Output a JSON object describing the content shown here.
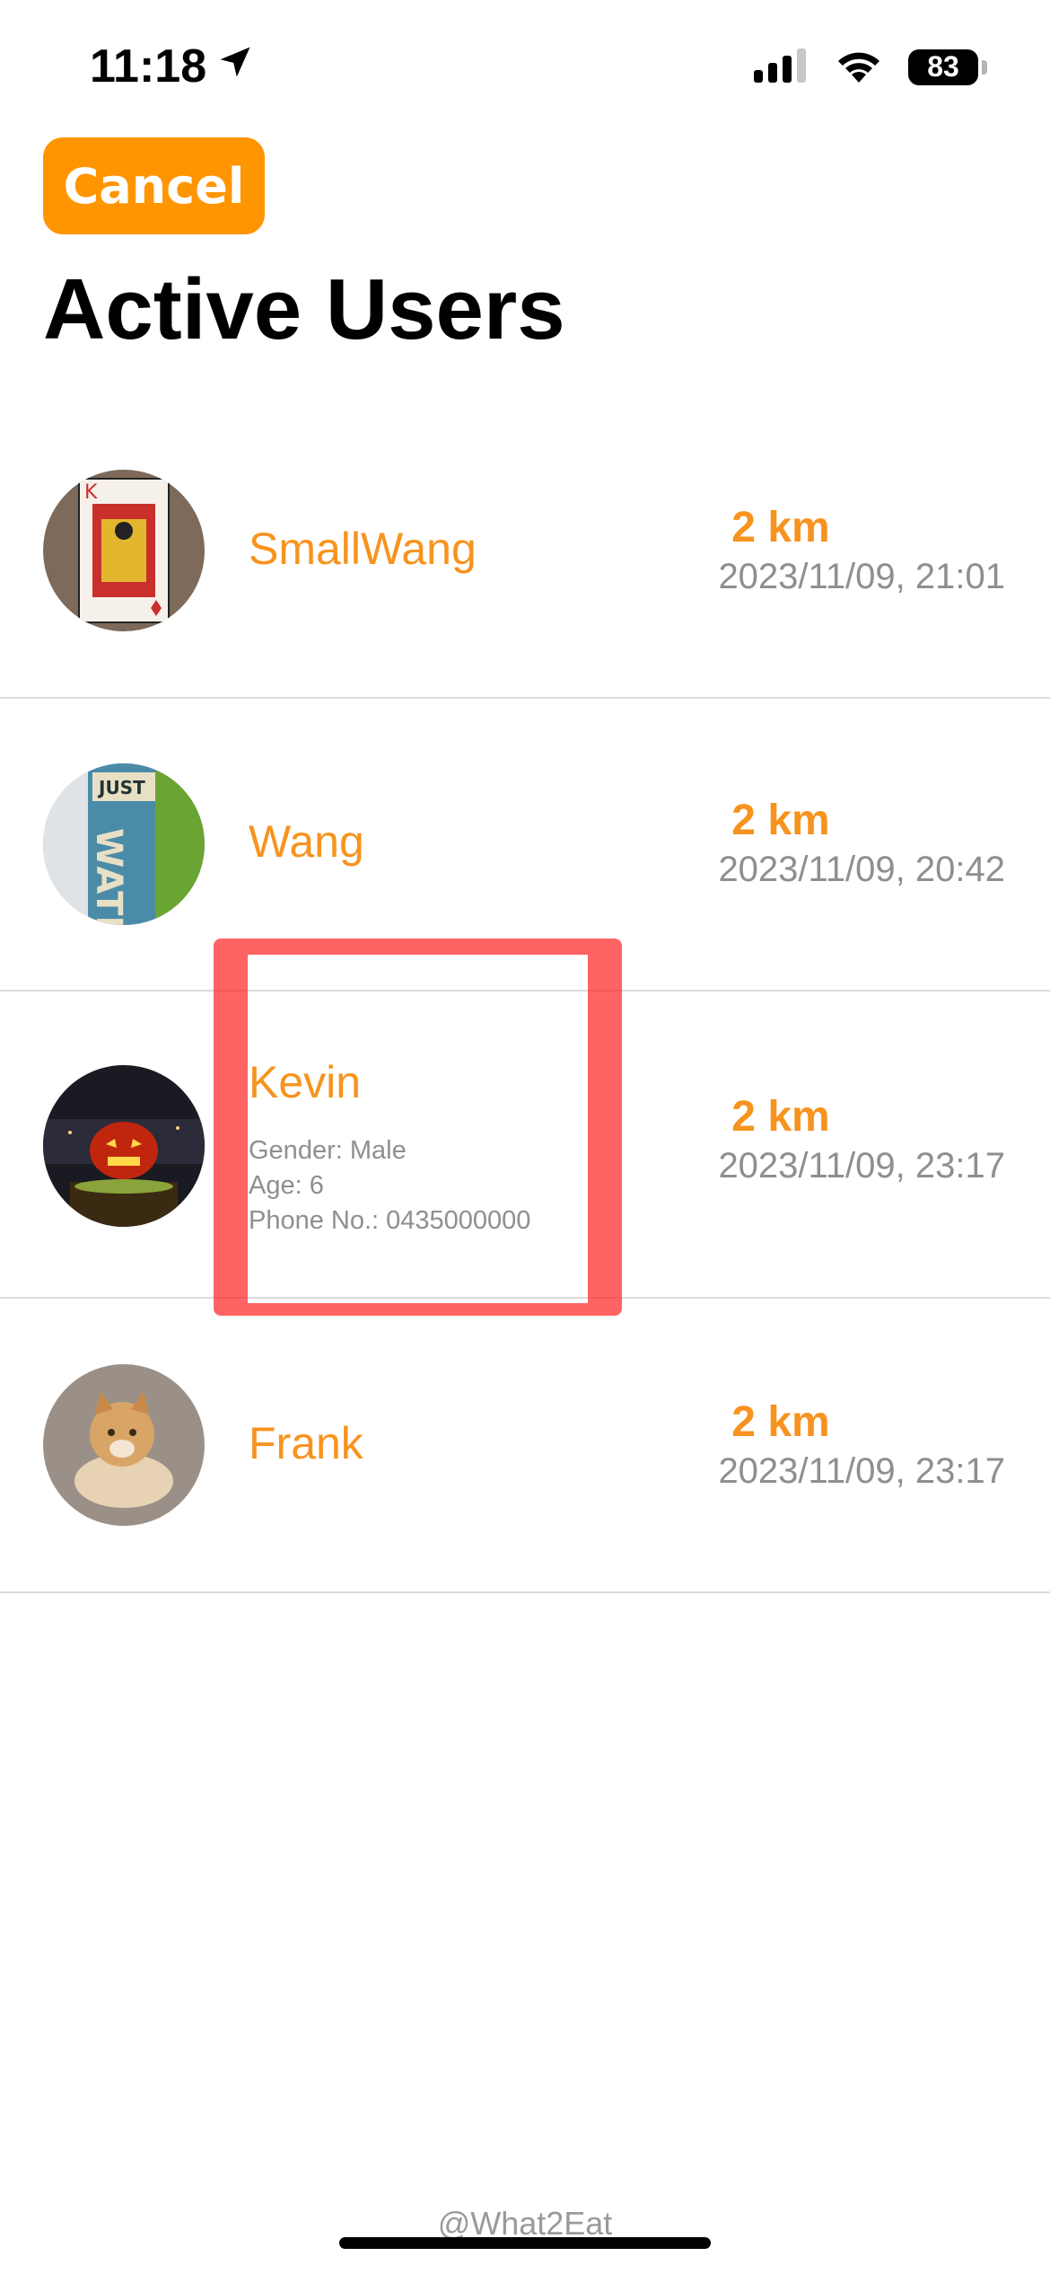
{
  "status_bar": {
    "time": "11:18",
    "battery": "83"
  },
  "header": {
    "cancel_label": "Cancel",
    "title": "Active Users"
  },
  "users": [
    {
      "name": "SmallWang",
      "distance": "2 km",
      "timestamp": "2023/11/09, 21:01"
    },
    {
      "name": "Wang",
      "distance": "2 km",
      "timestamp": "2023/11/09, 20:42"
    },
    {
      "name": "Kevin",
      "gender": "Gender: Male",
      "age": "Age: 6",
      "phone": "Phone No.: 0435000000",
      "distance": "2 km",
      "timestamp": "2023/11/09, 23:17"
    },
    {
      "name": "Frank",
      "distance": "2 km",
      "timestamp": "2023/11/09, 23:17"
    }
  ],
  "footer": {
    "watermark": "@What2Eat"
  },
  "colors": {
    "accent": "#ff9500",
    "name_text": "#f7931e",
    "secondary_text": "#8e8e93",
    "highlight": "#ff2828"
  }
}
